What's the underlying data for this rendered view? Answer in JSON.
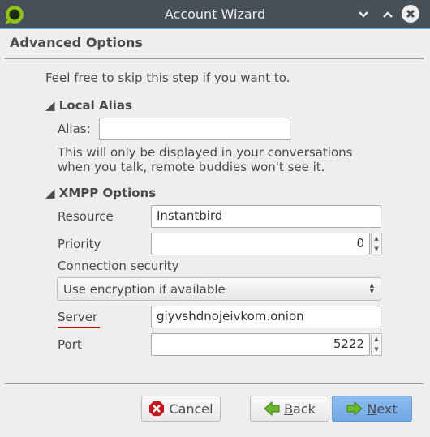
{
  "window": {
    "title": "Account Wizard"
  },
  "page": {
    "heading": "Advanced Options",
    "intro": "Feel free to skip this step if you want to."
  },
  "local_alias": {
    "heading": "Local Alias",
    "alias_label": "Alias:",
    "alias_value": "",
    "note_line1": "This will only be displayed in your conversations",
    "note_line2": "when you talk, remote buddies won't see it."
  },
  "xmpp": {
    "heading": "XMPP Options",
    "resource_label": "Resource",
    "resource_value": "Instantbird",
    "priority_label": "Priority",
    "priority_value": "0",
    "security_label": "Connection security",
    "security_value": "Use encryption if available",
    "server_label": "Server",
    "server_value": "giyvshdnojeivkom.onion",
    "port_label": "Port",
    "port_value": "5222"
  },
  "buttons": {
    "cancel": "Cancel",
    "back_mnemonic": "B",
    "back_rest": "ack",
    "next_mnemonic": "N",
    "next_rest": "ext"
  },
  "colors": {
    "accent": "#5aa8e6",
    "error_underline": "#cc0000",
    "next_button": "#7fb2ea"
  }
}
